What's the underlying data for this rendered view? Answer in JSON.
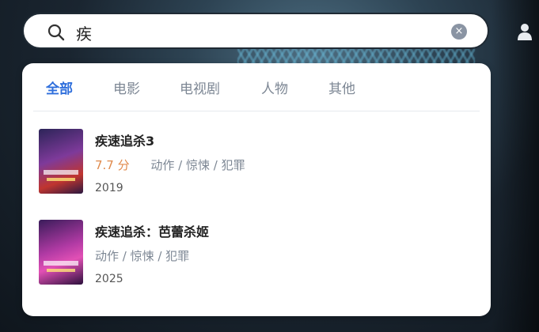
{
  "search": {
    "value": "疾",
    "clear_icon": "×"
  },
  "tabs": [
    {
      "label": "全部",
      "active": true
    },
    {
      "label": "电影",
      "active": false
    },
    {
      "label": "电视剧",
      "active": false
    },
    {
      "label": "人物",
      "active": false
    },
    {
      "label": "其他",
      "active": false
    }
  ],
  "results": [
    {
      "title": "疾速追杀3",
      "score": "7.7 分",
      "genres": "动作 / 惊悚 / 犯罪",
      "year": "2019"
    },
    {
      "title": "疾速追杀：芭蕾杀姬",
      "genres": "动作 / 惊悚 / 犯罪",
      "year": "2025"
    }
  ],
  "colors": {
    "accent": "#2f6fdc",
    "score": "#e08a4c"
  }
}
